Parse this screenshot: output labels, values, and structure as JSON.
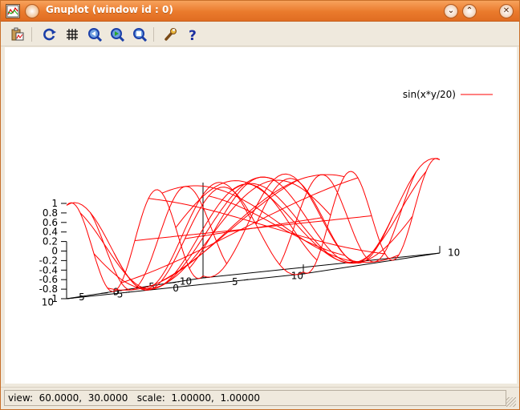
{
  "window": {
    "title": "Gnuplot (window id : 0)",
    "minimize_glyph": "⌄",
    "maximize_glyph": "⌃",
    "close_glyph": "✕"
  },
  "toolbar": {
    "items": [
      {
        "name": "copy-to-clipboard-icon"
      },
      {
        "name": "replot-icon"
      },
      {
        "name": "grid-icon"
      },
      {
        "name": "zoom-previous-icon"
      },
      {
        "name": "zoom-next-icon"
      },
      {
        "name": "unzoom-icon"
      },
      {
        "name": "preferences-wrench-icon"
      },
      {
        "name": "help-icon"
      }
    ]
  },
  "colors": {
    "curve": "#ff0000",
    "axis": "#000000",
    "title_gradient_top": "#f7a25c",
    "title_gradient_bottom": "#e06d22"
  },
  "chart_data": {
    "type": "surface",
    "function": "sin(x*y/20)",
    "legend": "sin(x*y/20)",
    "legend_position": "top-right",
    "x_range": [
      -10,
      10
    ],
    "y_range": [
      -10,
      10
    ],
    "z_range": [
      -1,
      1
    ],
    "z_ticks": [
      "1",
      "0.8",
      "0.6",
      "0.4",
      "0.2",
      "0",
      "-0.2",
      "-0.4",
      "-0.6",
      "-0.8",
      "-1"
    ],
    "x_ticks": [
      "-10",
      "-5",
      "0",
      "5",
      "10"
    ],
    "y_ticks": [
      "-5",
      "0",
      "5",
      "10"
    ],
    "y_ticks_end": "10",
    "isosamples": 10,
    "view": {
      "rot_x": 60,
      "rot_z": 30,
      "scale": 1,
      "scale_z": 1
    }
  },
  "status": {
    "text": "view:  60.0000,  30.0000   scale:  1.00000,  1.00000"
  }
}
